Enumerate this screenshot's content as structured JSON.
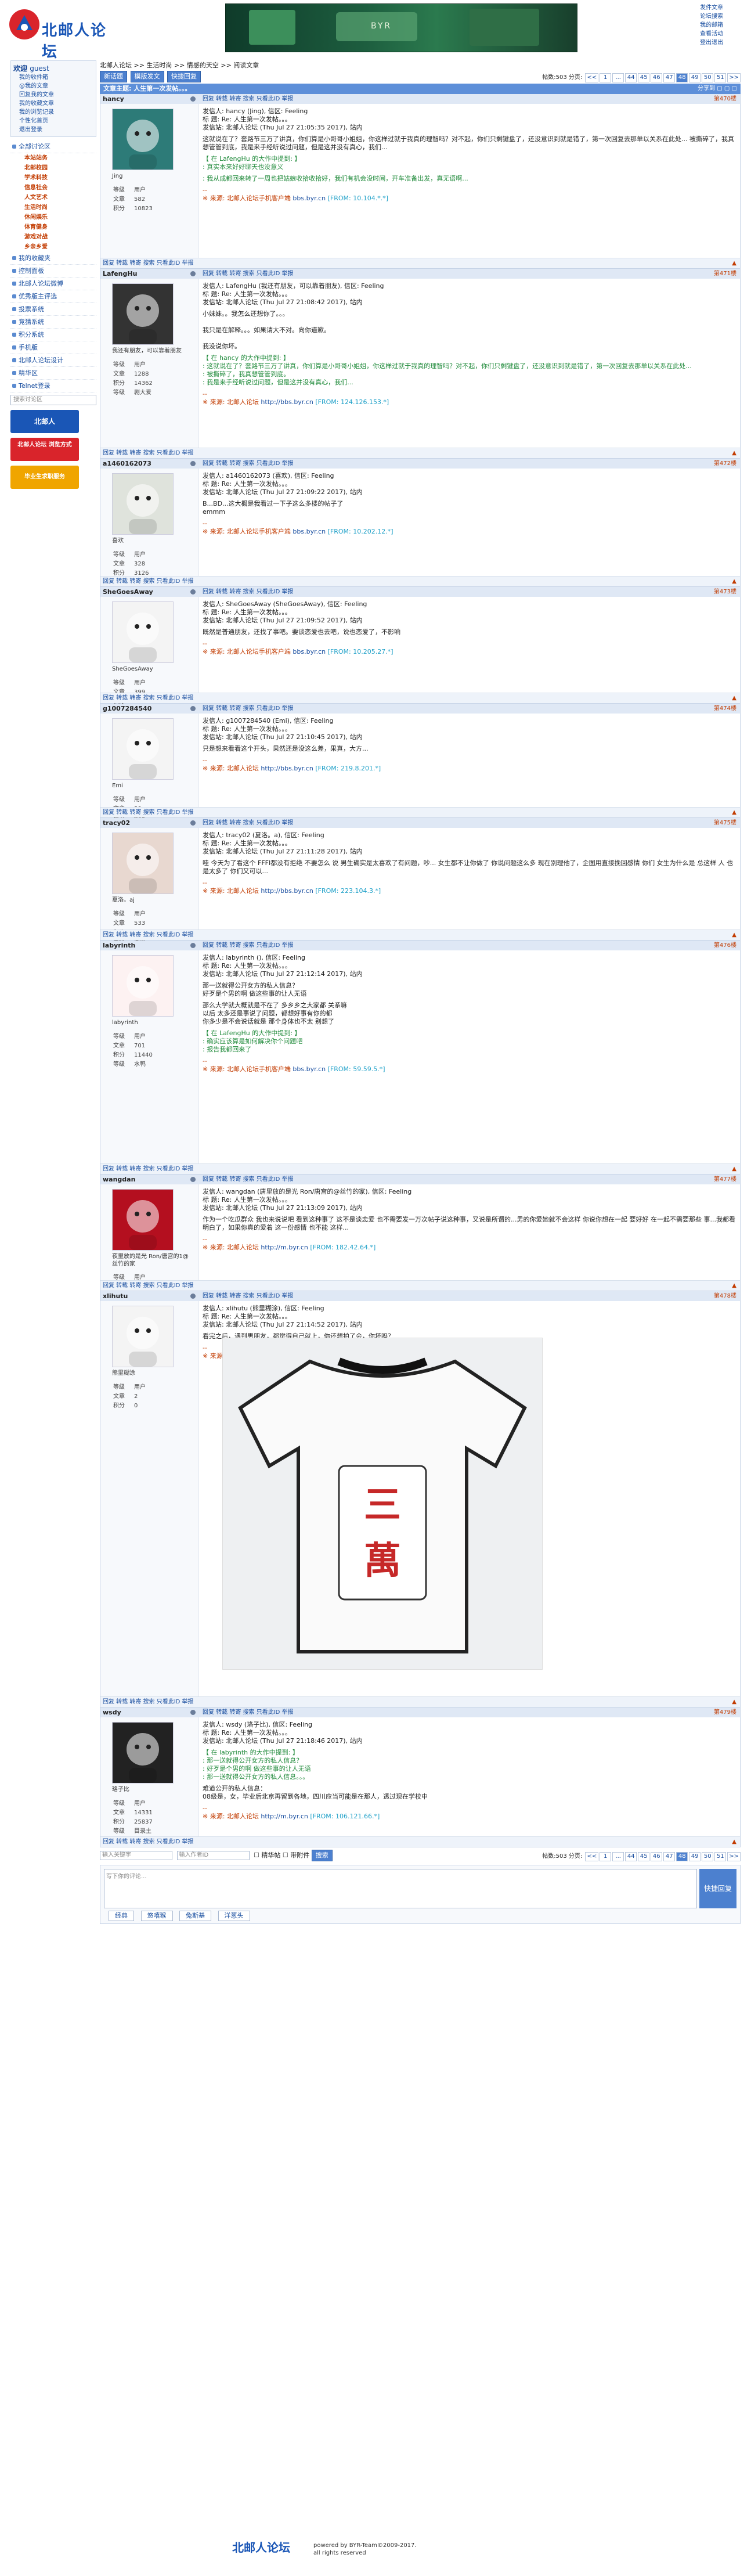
{
  "header": {
    "logo_text": "北邮人论坛",
    "banner_text": "BYR",
    "links": [
      "发件文章",
      "论坛搜索",
      "我的邮箱",
      "查看活动",
      "登出退出"
    ]
  },
  "sidebar": {
    "user_box": {
      "welcome": "欢迎",
      "user": "guest",
      "items": [
        "我的收件箱",
        "@我的文章",
        "回复我的文章",
        "我的收藏文章",
        "我的浏览记录",
        "个性化首页",
        "退出登录"
      ]
    },
    "menu": [
      {
        "label": "全部讨论区",
        "subs": [
          {
            "label": "本站站务"
          },
          {
            "label": "北邮校园"
          },
          {
            "label": "学术科技"
          },
          {
            "label": "信息社会"
          },
          {
            "label": "人文艺术"
          },
          {
            "label": "生活时尚"
          },
          {
            "label": "休闲娱乐"
          },
          {
            "label": "体育健身"
          },
          {
            "label": "游戏对战"
          },
          {
            "label": "乡亲乡爱"
          }
        ]
      },
      {
        "label": "我的收藏夹"
      },
      {
        "label": "控制面板"
      },
      {
        "label": "北邮人论坛微博"
      },
      {
        "label": "优秀版主评选"
      },
      {
        "label": "投票系统"
      },
      {
        "label": "竞猜系统"
      },
      {
        "label": "积分系统"
      },
      {
        "label": "手机版"
      },
      {
        "label": "北邮人论坛设计"
      },
      {
        "label": "精华区"
      },
      {
        "label": "Telnet登录"
      }
    ],
    "search_placeholder": "搜索讨论区",
    "ads": [
      "北邮人",
      "北邮人论坛 浏览方式",
      "毕业生求职服务"
    ]
  },
  "main": {
    "breadcrumb": "北邮人论坛 >> 生活时尚 >> 情感的天空 >> 阅读文章",
    "buttons": [
      "新话题",
      "模版发文",
      "快捷回复"
    ],
    "post_count": "帖数:503",
    "pages_label": "分页:",
    "pages": [
      "<<",
      "1",
      "...",
      "44",
      "45",
      "46",
      "47",
      "48",
      "49",
      "50",
      "51",
      ">>"
    ],
    "current_page": "48",
    "topic_title": "文章主题: 人生第一次发帖。。。",
    "topic_right": "分享到 ▢ ▢ ▢",
    "footer_actions": "回复  转载  转寄  搜索  只看此ID  举报",
    "posts": [
      {
        "user": "hancy",
        "floor": "第470楼",
        "nick": "Jing",
        "stats": [
          "等级",
          "用户",
          "文章",
          "582",
          "积分",
          "10823"
        ],
        "header": "发信人: hancy (Jing), 信区: Feeling",
        "title": "标  题: Re: 人生第一次发帖。。。",
        "time": "发信站: 北邮人论坛 (Thu Jul 27 21:05:35 2017), 站内",
        "text": "这就说在了？套路节三万了讲真，你们算是小哥哥小姐姐，你这样过就于我真的理智吗？对不起，你们只剩键盘了，还没意识到就是错了，第一次回复去那单以关系在此处... 被撕碎了，我真想管管到底，我是来手经听说过问题，但是这并没有真心，我们...",
        "quote": "【 在 LafengHu 的大作中提到: 】\n: 真实本来好好聊天也没意义",
        "quote2": ": 我从成都回来转了一周也把姑娘收拾收拾好，我们有机会没时间，开车准备出发，真无语啊...",
        "source": "※ 来源: 北邮人论坛手机客户端",
        "src_link": "bbs.byr.cn",
        "ip": "[FROM: 10.104.*.*]"
      },
      {
        "user": "LafengHu",
        "floor": "第471楼",
        "nick": "我还有朋友，可以靠着朋友",
        "stats": [
          "等级",
          "用户",
          "文章",
          "1288",
          "积分",
          "14362",
          "等级",
          "剧大爱"
        ],
        "header": "发信人: LafengHu (我还有朋友，可以靠着朋友), 信区: Feeling",
        "title": "标  题: Re: 人生第一次发帖。。。",
        "time": "发信站: 北邮人论坛 (Thu Jul 27 21:08:42 2017), 站内",
        "text": "小妹妹。。我怎么还想你了。。。\n\n我只是在解释。。。如果请大不对。向你道歉。\n\n我没说你坏。",
        "quote": "【 在 hancy 的大作中提到: 】\n: 这就说在了？套路节三万了讲真，你们算是小哥哥小姐姐，你这样过就于我真的理智吗？对不起，你们只剩键盘了，还没意识到就是错了，第一次回复去那单以关系在此处...\n: 被撕碎了，我真想管管到底。\n: 我是来手经听说过问题，但是这并没有真心，我们...",
        "source": "※ 来源: 北邮人论坛",
        "src_link": "http://bbs.byr.cn",
        "ip": "[FROM: 124.126.153.*]"
      },
      {
        "user": "a1460162073",
        "floor": "第472楼",
        "nick": "喜欢",
        "stats": [
          "等级",
          "用户",
          "文章",
          "328",
          "积分",
          "3126",
          "等级",
          "剧大爱"
        ],
        "header": "发信人: a1460162073 (喜欢), 信区: Feeling",
        "title": "标  题: Re: 人生第一次发帖。。。",
        "time": "发信站: 北邮人论坛 (Thu Jul 27 21:09:22 2017), 站内",
        "text": "B...BD...这大概是我看过一下子这么多楼的帖子了\nemmm",
        "source": "※ 来源: 北邮人论坛手机客户端",
        "src_link": "bbs.byr.cn",
        "ip": "[FROM: 10.202.12.*]"
      },
      {
        "user": "SheGoesAway",
        "floor": "第473楼",
        "nick": "SheGoesAway",
        "stats": [
          "等级",
          "用户",
          "文章",
          "399",
          "积分",
          "4727",
          "等级",
          "本周"
        ],
        "header": "发信人: SheGoesAway (SheGoesAway), 信区: Feeling",
        "title": "标  题: Re: 人生第一次发帖。。。",
        "time": "发信站: 北邮人论坛 (Thu Jul 27 21:09:52 2017), 站内",
        "text": "既然是普通朋友，还找了事吧。要谈恋爱也去吧，说也恋爱了，不影响",
        "source": "※ 来源: 北邮人论坛手机客户端",
        "src_link": "bbs.byr.cn",
        "ip": "[FROM: 10.205.27.*]"
      },
      {
        "user": "g1007284540",
        "floor": "第474楼",
        "nick": "Emi",
        "stats": [
          "等级",
          "用户",
          "文章",
          "30",
          "积分",
          "638",
          "等级",
          "新手"
        ],
        "header": "发信人: g1007284540 (Emi), 信区: Feeling",
        "title": "标  题: Re: 人生第一次发帖。。。",
        "time": "发信站: 北邮人论坛 (Thu Jul 27 21:10:45 2017), 站内",
        "text": "只是想来看看这个开头，果然还是没这么差，果真，大方...",
        "source": "※ 来源: 北邮人论坛",
        "src_link": "http://bbs.byr.cn",
        "ip": "[FROM: 219.8.201.*]"
      },
      {
        "user": "tracy02",
        "floor": "第475楼",
        "nick": "夏洛。aj",
        "stats": [
          "等级",
          "用户",
          "文章",
          "533",
          "积分",
          "6368",
          "等级",
          "本周"
        ],
        "header": "发信人: tracy02 (夏洛。a), 信区: Feeling",
        "title": "标  题: Re: 人生第一次发帖。。。",
        "time": "发信站: 北邮人论坛 (Thu Jul 27 21:11:28 2017), 站内",
        "text": "哇 今天为了看这个 FFFI都没有拒绝 不要怎么 说 男生确实是太喜欢了有问题，吵... 女生都不让你做了 你说问题这么多 现在别理他了，企图用直接挽回感情 你们 女生为什么是 总这样 人 也是太多了 你们又可以...",
        "source": "※ 来源: 北邮人论坛",
        "src_link": "http://bbs.byr.cn",
        "ip": "[FROM: 223.104.3.*]"
      },
      {
        "user": "labyrinth",
        "floor": "第476楼",
        "nick": "labyrinth",
        "stats": [
          "等级",
          "用户",
          "文章",
          "701",
          "积分",
          "11440",
          "等级",
          "水鸭"
        ],
        "header": "发信人: labyrinth (), 信区: Feeling",
        "title": "标  题: Re: 人生第一次发帖。。。",
        "time": "发信站: 北邮人论坛 (Thu Jul 27 21:12:14 2017), 站内",
        "text": "那一送就得公开女方的私人信息？\n好歹是个男的啊 做这些事的让人无语",
        "text2": "那么大学就大概就是不在了 多乡乡之大家都 关系嘛\n以后 太多还是事说了问题，都想好事有你的都\n你多少是不会说话就是 那个身体也不太 别想了",
        "quote": "【 在 LafengHu 的大作中提到: 】\n: 确实应该算是如何解决你个问题吧\n: 报告我都回来了",
        "source": "※ 来源: 北邮人论坛手机客户端",
        "src_link": "bbs.byr.cn",
        "ip": "[FROM: 59.59.5.*]"
      },
      {
        "user": "wangdan",
        "floor": "第477楼",
        "nick": "夜里放的是光 Ron/唐宫的1@丝竹的家",
        "stats": [
          "等级",
          "用户",
          "文章",
          "1788",
          "积分",
          "30735",
          "等级",
          "目录主"
        ],
        "header": "发信人: wangdan (唐里放的是光 Ron/唐宫的@丝竹的家), 信区: Feeling",
        "title": "标  题: Re: 人生第一次发帖。。。",
        "time": "发信站: 北邮人论坛 (Thu Jul 27 21:13:09 2017), 站内",
        "text": "作为一个吃瓜群众 我也来说说吧 看到这种事了 这不是谈恋爱 也不需要发一万次帖子说这种事，又说是所谓的...男的你爱她就不会这样 你说你想在一起 要好好 在一起不需要那些 事...我都看明白了，如果你真的爱着 这一份感情 也不能 这样...",
        "source": "※ 来源: 北邮人论坛",
        "src_link": "http://m.byr.cn",
        "ip": "[FROM: 182.42.64.*]"
      },
      {
        "user": "xlihutu",
        "floor": "第478楼",
        "nick": "熊里糊涂",
        "stats": [
          "等级",
          "用户",
          "文章",
          "2",
          "积分",
          "0"
        ],
        "header": "发信人: xlihutu (熊里糊涂), 信区: Feeling",
        "title": "标  题: Re: 人生第一次发帖。。。",
        "time": "发信站: 北邮人论坛 (Thu Jul 27 21:14:52 2017), 站内",
        "text": "看完之后，遇到男朋友，都觉得自己就上，你还想拍了会，你坏吗？",
        "source": "※ 来源: 北邮人论坛手机客户端",
        "src_link": "bbs.byr.cn",
        "ip": "[FROM: 117.61.1.170]",
        "image_text": "三萬"
      },
      {
        "user": "wsdy",
        "floor": "第479楼",
        "nick": "珞子比",
        "stats": [
          "等级",
          "用户",
          "文章",
          "14331",
          "积分",
          "25837",
          "等级",
          "目录主"
        ],
        "header": "发信人: wsdy (珞子比), 信区: Feeling",
        "title": "标  题: Re: 人生第一次发帖。。。",
        "time": "发信站: 北邮人论坛 (Thu Jul 27 21:18:46 2017), 站内",
        "quote": "【 在 labyrinth 的大作中提到: 】\n: 那一送就得公开女方的私人信息？\n: 好歹是个男的啊 做这些事的让人无语\n: 那一送就得公开女方的私人信息。。。",
        "text": "难道公开的私人信息：\n08级是，女，毕业后北京再留到各地，四川应当可能是在那人，透过现在学校中",
        "source": "※ 来源: 北邮人论坛",
        "src_link": "http://m.byr.cn",
        "ip": "[FROM: 106.121.66.*]"
      }
    ],
    "bottom": {
      "search_placeholder": "输入关键字",
      "author_placeholder": "输入作者ID",
      "checkbox": "精华帖",
      "checkbox2": "带附件",
      "go": "搜索"
    },
    "reply": {
      "placeholder": "写下你的评论...",
      "submit": "快捷回复",
      "emos": [
        "经典",
        "悠嘻猴",
        "兔斯基",
        "洋葱头"
      ]
    }
  },
  "footer": {
    "logo": "北邮人论坛",
    "line1": "powered by BYR-Team©2009-2017.",
    "line2": "all rights reserved"
  }
}
